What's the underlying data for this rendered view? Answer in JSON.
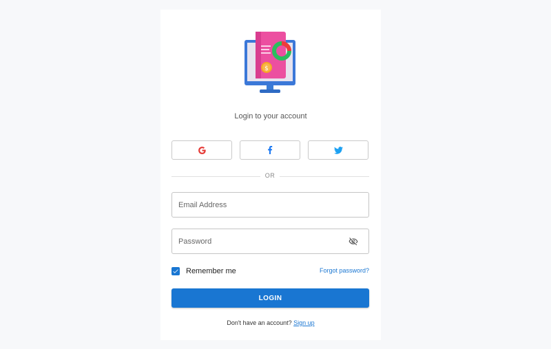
{
  "header": {
    "logo_icon": "monitor-invoice-icon",
    "subtitle": "Login to your account"
  },
  "social": [
    {
      "name": "google",
      "icon": "google-icon",
      "color": "#e53935"
    },
    {
      "name": "facebook",
      "icon": "facebook-icon",
      "color": "#1877f2"
    },
    {
      "name": "twitter",
      "icon": "twitter-icon",
      "color": "#1da1f2"
    }
  ],
  "divider": {
    "label": "OR"
  },
  "form": {
    "email_placeholder": "Email Address",
    "email_value": "",
    "password_placeholder": "Password",
    "password_value": "",
    "password_toggle_icon": "eye-off-icon",
    "remember_label": "Remember me",
    "remember_checked": true,
    "forgot_label": "Forgot password?",
    "login_label": "LOGIN"
  },
  "footer": {
    "prompt": "Don't have an account?",
    "signup_label": "Sign up"
  },
  "colors": {
    "accent": "#1976d2",
    "page_bg": "#f7f8fa",
    "card_bg": "#ffffff"
  }
}
